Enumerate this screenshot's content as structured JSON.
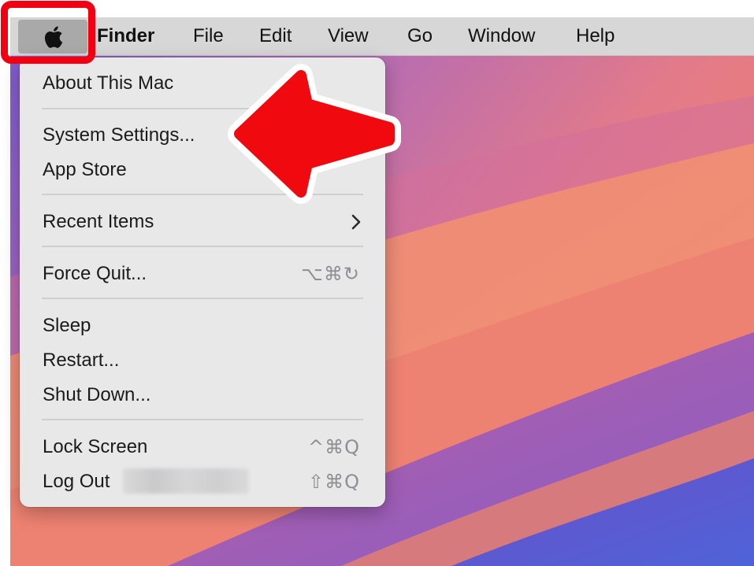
{
  "menubar": {
    "items": [
      "Finder",
      "File",
      "Edit",
      "View",
      "Go",
      "Window",
      "Help"
    ]
  },
  "menu": {
    "about": "About This Mac",
    "system_settings": "System Settings...",
    "app_store": "App Store",
    "recent_items": "Recent Items",
    "force_quit": "Force Quit...",
    "force_quit_shortcut": "⌥⌘↻",
    "sleep": "Sleep",
    "restart": "Restart...",
    "shut_down": "Shut Down...",
    "lock_screen": "Lock Screen",
    "lock_screen_shortcut": "^⌘Q",
    "log_out": "Log Out",
    "log_out_shortcut": "⇧⌘Q"
  },
  "icons": {
    "apple": "apple-logo-icon",
    "submenu": "chevron-right-icon",
    "annotation_arrow": "red-arrow-left"
  },
  "colors": {
    "highlight": "#f20012",
    "menubar": "#d7d7d8",
    "menu_bg": "#e8e8e9"
  }
}
